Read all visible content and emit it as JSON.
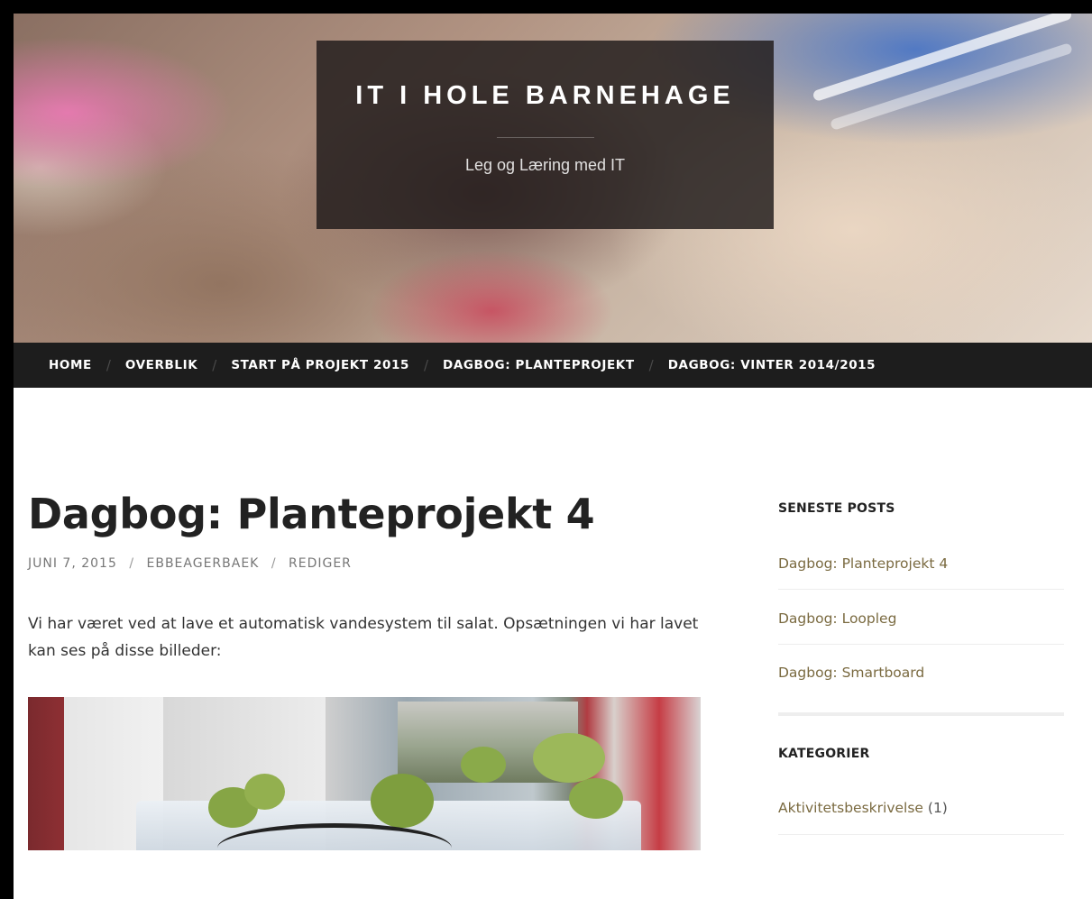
{
  "site": {
    "title": "IT I HOLE BARNEHAGE",
    "description": "Leg og Læring med IT"
  },
  "nav": {
    "separator": "/",
    "items": [
      {
        "label": "HOME"
      },
      {
        "label": "OVERBLIK"
      },
      {
        "label": "START PÅ PROJEKT 2015"
      },
      {
        "label": "DAGBOG: PLANTEPROJEKT"
      },
      {
        "label": "DAGBOG: VINTER 2014/2015"
      }
    ]
  },
  "post": {
    "title": "Dagbog: Planteprojekt 4",
    "meta": {
      "date": "JUNI 7, 2015",
      "author": "EBBEAGERBAEK",
      "edit": "REDIGER",
      "separator": "/"
    },
    "body": "Vi har været ved at lave et automatisk vandesystem til salat. Opsætningen vi har lavet kan ses på disse billeder:"
  },
  "sidebar": {
    "recent": {
      "title": "SENESTE POSTS",
      "items": [
        {
          "label": "Dagbog: Planteprojekt 4"
        },
        {
          "label": "Dagbog: Loopleg"
        },
        {
          "label": "Dagbog: Smartboard"
        }
      ]
    },
    "categories": {
      "title": "KATEGORIER",
      "items": [
        {
          "label": "Aktivitetsbeskrivelse",
          "count": "(1)"
        }
      ]
    }
  },
  "colors": {
    "nav_bg": "#1d1d1d",
    "link": "#7a6a40",
    "title_box": "#1e1a1a"
  }
}
